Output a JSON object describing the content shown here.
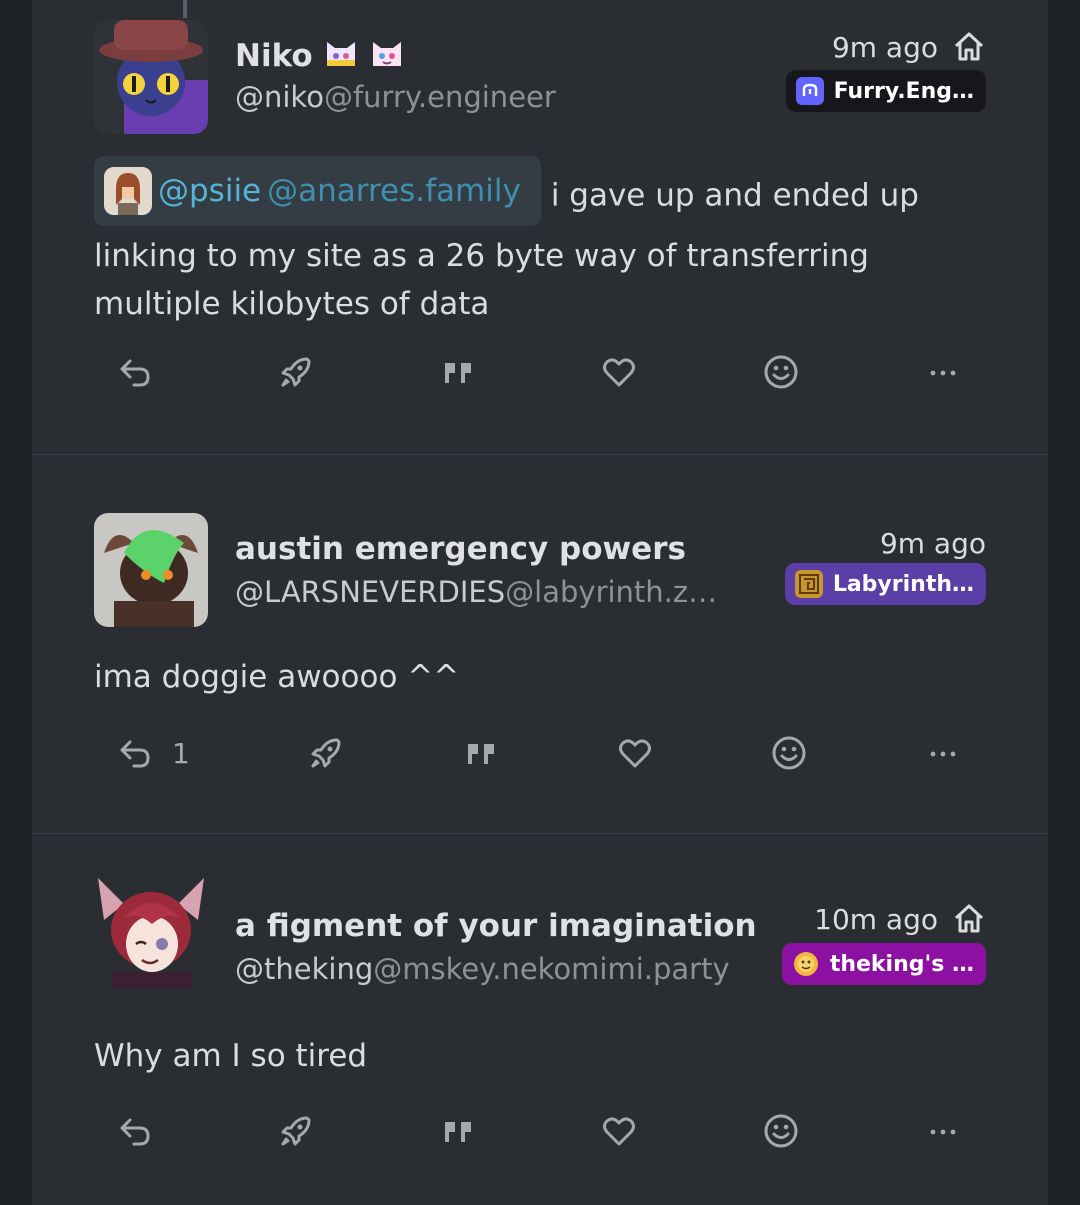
{
  "notes": [
    {
      "display_name": "Niko",
      "handle_user": "@niko",
      "handle_host": "@furry.engineer",
      "time": "9m ago",
      "instance": {
        "name": "Furry.Eng…",
        "color": "#16161c",
        "icon": "mastodon-icon"
      },
      "mention": {
        "user": "@psiie",
        "host": "@anarres.family"
      },
      "text_after_mention": "i gave up and ended up linking to my site as a 26 byte way of transferring multiple kilobytes of data",
      "reply_count": ""
    },
    {
      "display_name": "austin emergency powers",
      "handle_user": "@LARSNEVERDIES",
      "handle_host": "@labyrinth.z…",
      "time": "9m ago",
      "instance": {
        "name": "Labyrinth…",
        "color": "#5b3ea6",
        "icon": "labyrinth-icon"
      },
      "text": "ima doggie awoooo ^^",
      "reply_count": "1"
    },
    {
      "display_name": "a figment of your imagination",
      "handle_user": "@theking",
      "handle_host": "@mskey.nekomimi.party",
      "time": "10m ago",
      "instance": {
        "name": "theking's …",
        "color": "#8c10a2",
        "icon": "sun-face-icon"
      },
      "text": "Why am I so tired",
      "reply_count": ""
    }
  ],
  "colors": {
    "background": "#1f2326",
    "panel": "#2a2e32",
    "link": "#56b3d6"
  }
}
